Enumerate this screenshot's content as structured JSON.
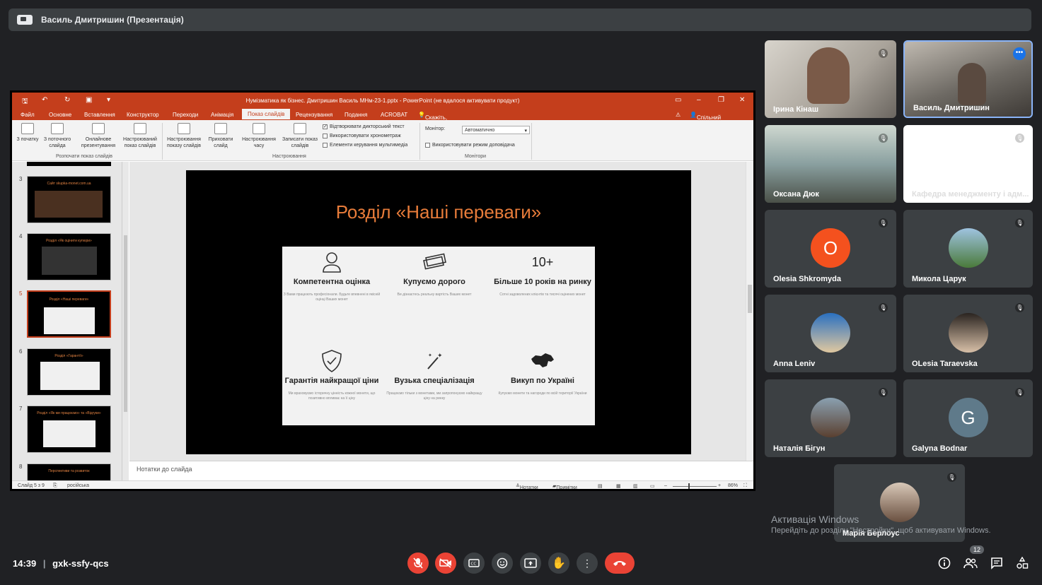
{
  "presenter_bar": {
    "title": "Василь Дмитришин (Презентація)"
  },
  "ppt": {
    "window_title": "Нумізматика як бізнес. Дмитришин Василь МНм-23-1.pptx - PowerPoint (не вдалося активувати продукт)",
    "tabs": [
      "Файл",
      "Основне",
      "Вставлення",
      "Конструктор",
      "Переходи",
      "Анімація",
      "Показ слайдів",
      "Рецензування",
      "Подання",
      "ACROBAT"
    ],
    "active_tab": "Показ слайдів",
    "tell_me": "Скажіть, що потрібно зробити...",
    "share": "Спільний доступ",
    "ribbon": {
      "btn_from_start": "З початку",
      "btn_from_current": "З поточного слайда",
      "btn_online": "Онлайнове презентування",
      "btn_custom": "Настроюваний показ слайдів",
      "group_start": "Розпочати показ слайдів",
      "btn_setup": "Настроювання показу слайдів",
      "btn_hide": "Приховати слайд",
      "btn_rehearse": "Настроювання часу",
      "btn_record": "Записати показ слайдів",
      "group_setup": "Настроювання",
      "chk_narration": "Відтворювати дикторський текст",
      "chk_timings": "Використовувати хронометраж",
      "chk_media": "Елементи керування мультимедіа",
      "monitor_label": "Монітор:",
      "monitor_value": "Автоматично",
      "chk_presenter": "Використовувати режим доповідача",
      "group_monitors": "Монітори"
    },
    "thumbnails": [
      {
        "num": "3",
        "caption": "Сайт skupka-monet.com.ua"
      },
      {
        "num": "4",
        "caption": "Розділ «Як оцінити купюри»"
      },
      {
        "num": "5",
        "caption": "Розділ «Наші переваги»"
      },
      {
        "num": "6",
        "caption": "Розділ «Гарантії»"
      },
      {
        "num": "7",
        "caption": "Розділ «Як ми працюємо» та «Відгуки»"
      },
      {
        "num": "8",
        "caption": "Перспективи та розвиток"
      }
    ],
    "slide": {
      "title": "Розділ «Наші переваги»",
      "features": [
        {
          "icon": "person-icon",
          "heading": "Компетентна оцінка",
          "desc": "З Вами працюють професіонали. Будьте впевнені в якісній оцінці Ваших монет"
        },
        {
          "icon": "money-icon",
          "heading": "Купуємо дорого",
          "desc": "Ви дізнаєтесь реальну вартість Ваших монет"
        },
        {
          "icon": "ten-plus",
          "icon_text": "10+",
          "heading": "Більше 10 років на ринку",
          "desc": "Сотні задоволених клієнтів та тисячі оцінених монет"
        },
        {
          "icon": "shield-check-icon",
          "heading": "Гарантія найкращої ціни",
          "desc": "Ми враховуємо історичну цінність кожної монети, що позитивно впливає на її ціну"
        },
        {
          "icon": "magic-wand-icon",
          "heading": "Вузька спеціалізація",
          "desc": "Працюємо тільки з монетами, ми запропонуємо найкращу ціну на ринку"
        },
        {
          "icon": "ukraine-map-icon",
          "heading": "Викуп по Україні",
          "desc": "Купуємо монети та нагороди по всій території України"
        }
      ]
    },
    "notes_placeholder": "Нотатки до слайда",
    "status": {
      "slide": "Слайд 5 з 9",
      "lang": "російська",
      "notes": "Нотатки",
      "comments": "Примітки",
      "zoom": "86%"
    }
  },
  "participants": [
    {
      "name": "Ірина Кінаш",
      "type": "video",
      "muted": true
    },
    {
      "name": "Василь Дмитришин",
      "type": "video",
      "active": true
    },
    {
      "name": "Оксана Дюк",
      "type": "video",
      "muted": true
    },
    {
      "name": "Кафедра менеджменту і адм...",
      "type": "blank",
      "muted": true
    },
    {
      "name": "Olesia Shkromyda",
      "type": "letter",
      "letter": "O",
      "color": "#f4511e",
      "muted": true
    },
    {
      "name": "Микола Царук",
      "type": "photo",
      "muted": true
    },
    {
      "name": "Anna Leniv",
      "type": "photo",
      "muted": true
    },
    {
      "name": "OLesia Taraevska",
      "type": "photo",
      "muted": true
    },
    {
      "name": "Наталія Бігун",
      "type": "photo",
      "muted": true
    },
    {
      "name": "Galyna Bodnar",
      "type": "letter",
      "letter": "G",
      "color": "#5f7a8a",
      "muted": true
    },
    {
      "name": "Марія Берлоус",
      "type": "photo",
      "muted": true
    }
  ],
  "watermark": {
    "line1": "Активація Windows",
    "line2": "Перейдіть до розділу \"Настройки\", щоб активувати Windows."
  },
  "bottom": {
    "time": "14:39",
    "meeting_code": "gxk-ssfy-qcs",
    "people_count": "12"
  }
}
